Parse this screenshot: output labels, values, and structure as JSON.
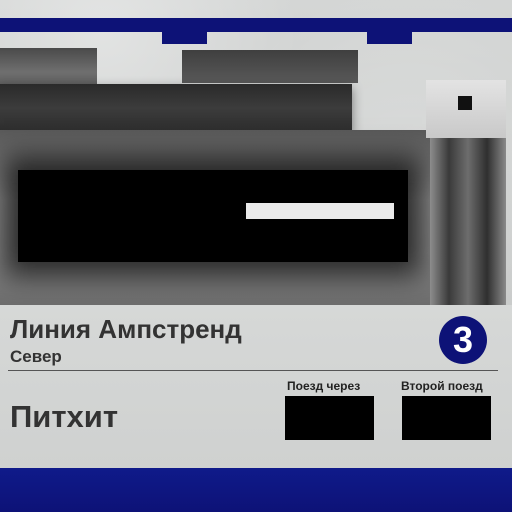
{
  "sign": {
    "line_name": "Линия Ампстренд",
    "direction": "Север",
    "line_number": "3",
    "station": "Питхит",
    "next_train_label": "Поезд через",
    "second_train_label": "Второй поезд"
  },
  "colors": {
    "stripe_blue": "#0d1277",
    "panel_grey": "#cfd1d0",
    "text_dark": "#333333"
  }
}
